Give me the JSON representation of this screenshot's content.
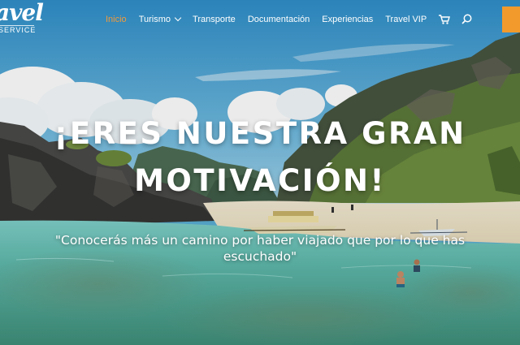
{
  "logo": {
    "main": "avel",
    "sub": "SERVICE"
  },
  "nav": {
    "items": [
      {
        "label": "Inicio",
        "active": true
      },
      {
        "label": "Turismo",
        "has_dropdown": true
      },
      {
        "label": "Transporte"
      },
      {
        "label": "Documentación"
      },
      {
        "label": "Experiencias"
      },
      {
        "label": "Travel VIP"
      }
    ],
    "icons": [
      "cart-icon",
      "search-icon"
    ]
  },
  "hero": {
    "headline_line1": "¡ERES NUESTRA GRAN",
    "headline_line2": "MOTIVACIÓN!",
    "subtitle_line1": "\"Conocerás más un camino por haber viajado que por lo que has",
    "subtitle_line2": "escuchado\""
  },
  "colors": {
    "accent": "#ef9a3c",
    "cta": "#f39a2c",
    "text": "#ffffff"
  }
}
